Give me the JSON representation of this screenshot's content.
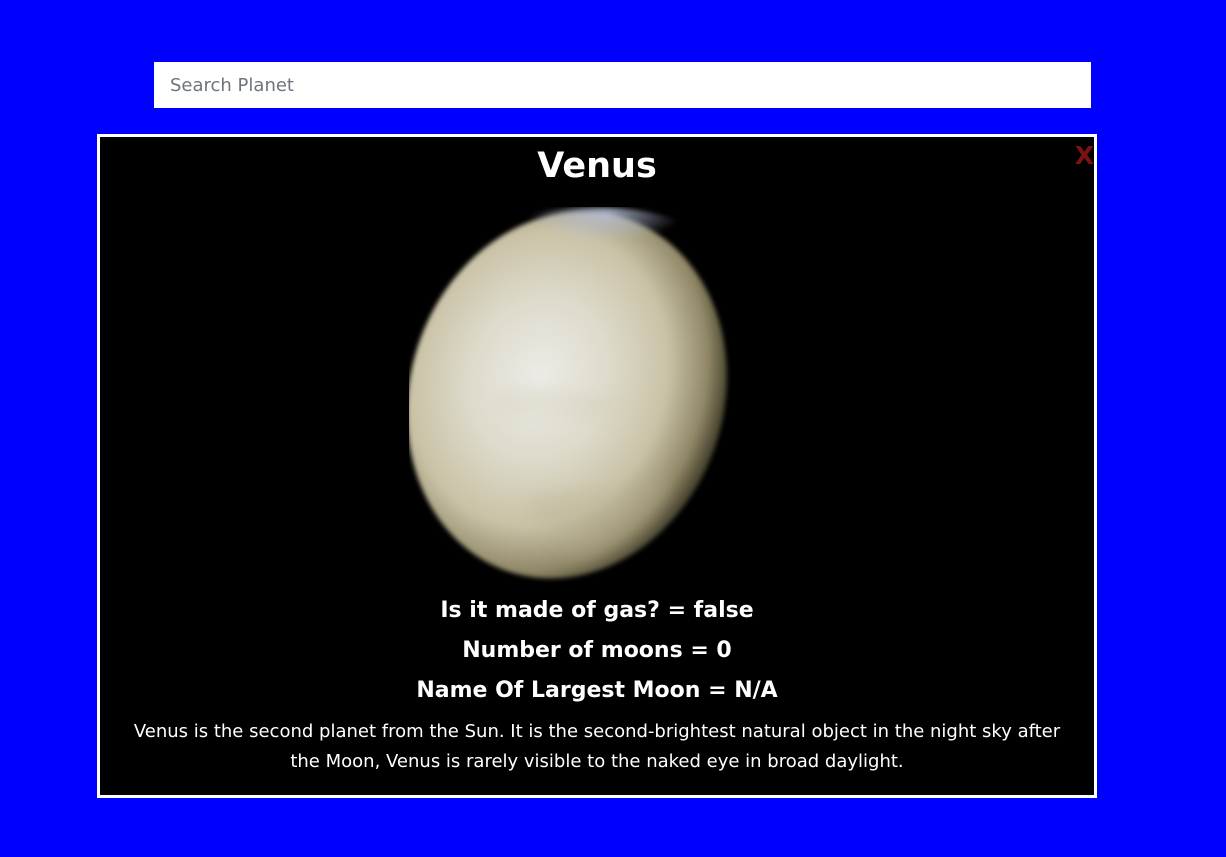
{
  "search": {
    "placeholder": "Search Planet",
    "value": ""
  },
  "planet_card": {
    "close_label": "X",
    "name": "Venus",
    "image_alt": "Venus",
    "facts": {
      "gas": "Is it made of gas? = false",
      "moons": "Number of moons = 0",
      "largest_moon": "Name Of Largest Moon = N/A"
    },
    "description": "Venus is the second planet from the Sun. It is the second-brightest natural object in the night sky after the Moon, Venus is rarely visible to the naked eye in broad daylight."
  },
  "colors": {
    "page_background": "#0000ff",
    "card_background": "#000000",
    "card_border": "#ffffff",
    "close_color": "#7a1212",
    "planet_surface": "#d8d4c4"
  }
}
